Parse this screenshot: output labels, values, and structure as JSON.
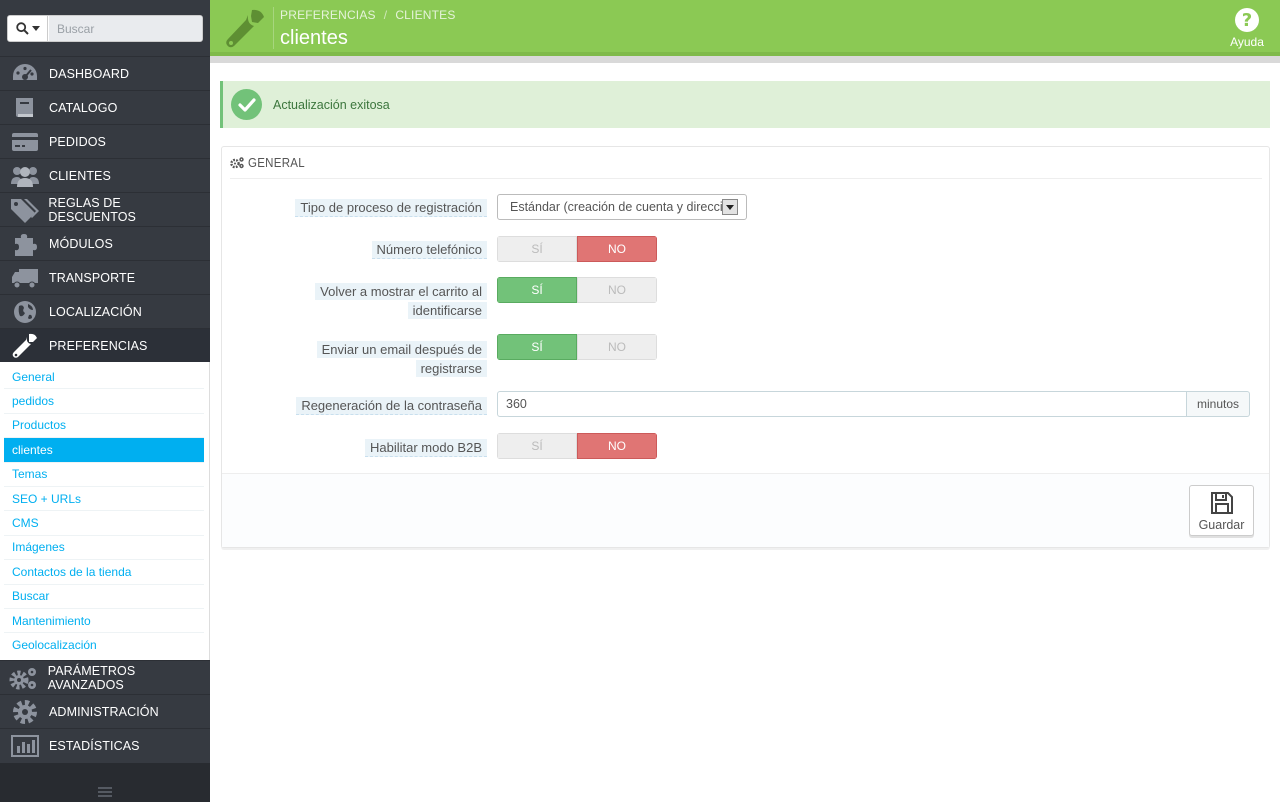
{
  "search": {
    "placeholder": "Buscar",
    "icon": "search-icon"
  },
  "sidebar": {
    "menu_top": [
      {
        "label": "DASHBOARD",
        "icon": "dashboard-icon"
      },
      {
        "label": "CATALOGO",
        "icon": "book-icon"
      },
      {
        "label": "PEDIDOS",
        "icon": "credit-card-icon"
      },
      {
        "label": "CLIENTES",
        "icon": "users-icon"
      },
      {
        "label": "REGLAS DE DESCUENTOS",
        "icon": "tags-icon"
      },
      {
        "label": "MÓDULOS",
        "icon": "puzzle-icon"
      },
      {
        "label": "TRANSPORTE",
        "icon": "truck-icon"
      },
      {
        "label": "LOCALIZACIÓN",
        "icon": "globe-icon"
      },
      {
        "label": "PREFERENCIAS",
        "icon": "wrench-icon"
      }
    ],
    "submenu": [
      "General",
      "pedidos",
      "Productos",
      "clientes",
      "Temas",
      "SEO + URLs",
      "CMS",
      "Imágenes",
      "Contactos de la tienda",
      "Buscar",
      "Mantenimiento",
      "Geolocalización"
    ],
    "submenu_current": "clientes",
    "menu_bottom": [
      {
        "label": "PARÁMETROS AVANZADOS",
        "icon": "cogs-icon"
      },
      {
        "label": "ADMINISTRACIÓN",
        "icon": "cog-icon"
      },
      {
        "label": "ESTADÍSTICAS",
        "icon": "bar-chart-icon"
      }
    ]
  },
  "header": {
    "breadcrumb_1": "PREFERENCIAS",
    "breadcrumb_sep": "/",
    "breadcrumb_2": "CLIENTES",
    "title": "clientes",
    "help_label": "Ayuda",
    "help_glyph": "?"
  },
  "alert": {
    "text": "Actualización exitosa"
  },
  "panel": {
    "heading": "GENERAL",
    "fields": {
      "registration_type": {
        "label": "Tipo de proceso de registración",
        "value": "Estándar (creación de cuenta y dirección"
      },
      "phone": {
        "label": "Número telefónico",
        "yes": "SÍ",
        "no": "NO",
        "selected": "NO"
      },
      "cart": {
        "label_1": "Volver a mostrar el carrito al",
        "label_2": "identificarse",
        "yes": "SÍ",
        "no": "NO",
        "selected": "SÍ"
      },
      "email": {
        "label_1": "Enviar un email después de",
        "label_2": "registrarse",
        "yes": "SÍ",
        "no": "NO",
        "selected": "SÍ"
      },
      "password": {
        "label": "Regeneración de la contraseña",
        "value": "360",
        "addon": "minutos"
      },
      "b2b": {
        "label": "Habilitar modo B2B",
        "yes": "SÍ",
        "no": "NO",
        "selected": "NO"
      }
    },
    "save_label": "Guardar"
  },
  "colors": {
    "header_green": "#8bc954",
    "sidebar_dark": "#363a41",
    "link_blue": "#00aff0",
    "success_green": "#72c279",
    "no_red": "#e07574"
  }
}
